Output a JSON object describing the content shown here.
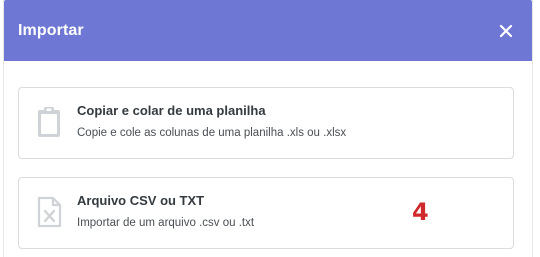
{
  "dialog": {
    "title": "Importar",
    "close_icon": "close-icon"
  },
  "options": [
    {
      "title": "Copiar e colar de uma planilha",
      "description": "Copie e cole as colunas de uma planilha .xls ou .xlsx",
      "icon": "clipboard-icon"
    },
    {
      "title": "Arquivo CSV ou TXT",
      "description": "Importar de um arquivo .csv ou .txt",
      "icon": "file-x-icon"
    }
  ],
  "annotation": {
    "label": "4"
  },
  "colors": {
    "header_bg": "#6e77d3",
    "annotation": "#d0292b"
  }
}
